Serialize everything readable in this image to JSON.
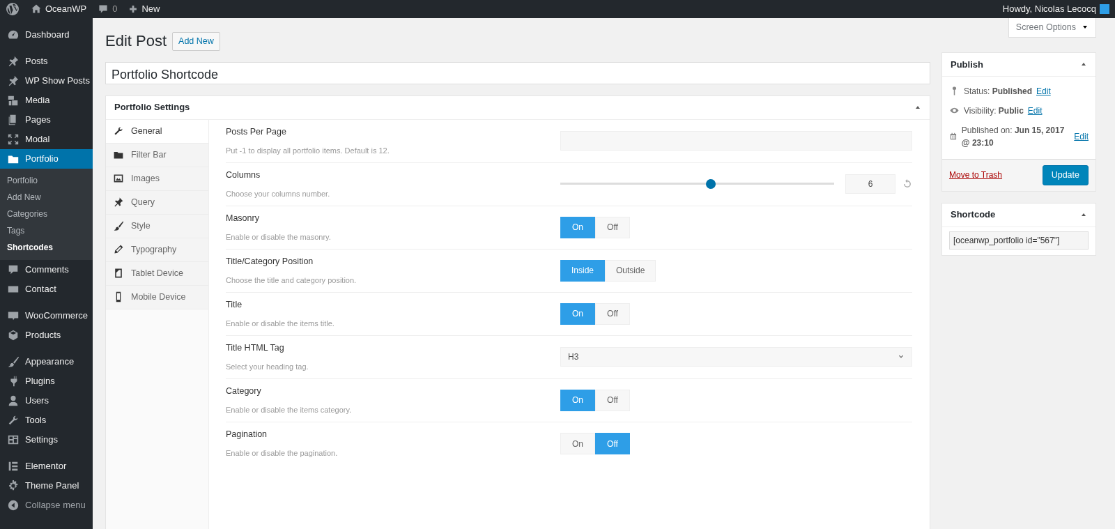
{
  "admin_bar": {
    "site": "OceanWP",
    "comments": "0",
    "new": "New",
    "greeting": "Howdy, Nicolas Lecocq"
  },
  "sidebar": {
    "groups": [
      [
        {
          "label": "Dashboard",
          "selected": false
        }
      ],
      [
        {
          "label": "Posts",
          "selected": false
        },
        {
          "label": "WP Show Posts",
          "selected": false
        },
        {
          "label": "Media",
          "selected": false
        },
        {
          "label": "Pages",
          "selected": false
        },
        {
          "label": "Modal",
          "selected": false
        },
        {
          "label": "Portfolio",
          "selected": true,
          "children": [
            {
              "label": "Portfolio",
              "selected": false
            },
            {
              "label": "Add New",
              "selected": false
            },
            {
              "label": "Categories",
              "selected": false
            },
            {
              "label": "Tags",
              "selected": false
            },
            {
              "label": "Shortcodes",
              "selected": true
            }
          ]
        },
        {
          "label": "Comments",
          "selected": false
        },
        {
          "label": "Contact",
          "selected": false
        }
      ],
      [
        {
          "label": "WooCommerce",
          "selected": false
        },
        {
          "label": "Products",
          "selected": false
        }
      ],
      [
        {
          "label": "Appearance",
          "selected": false
        },
        {
          "label": "Plugins",
          "selected": false
        },
        {
          "label": "Users",
          "selected": false
        },
        {
          "label": "Tools",
          "selected": false
        },
        {
          "label": "Settings",
          "selected": false
        }
      ],
      [
        {
          "label": "Elementor",
          "selected": false
        },
        {
          "label": "Theme Panel",
          "selected": false
        },
        {
          "label": "Collapse menu",
          "selected": false
        }
      ]
    ]
  },
  "screen_options": "Screen Options",
  "page_title": "Edit Post",
  "add_new": "Add New",
  "post_title": "Portfolio Shortcode",
  "settings_box": {
    "title": "Portfolio Settings",
    "tabs": [
      {
        "label": "General",
        "selected": true
      },
      {
        "label": "Filter Bar",
        "selected": false
      },
      {
        "label": "Images",
        "selected": false
      },
      {
        "label": "Query",
        "selected": false
      },
      {
        "label": "Style",
        "selected": false
      },
      {
        "label": "Typography",
        "selected": false
      },
      {
        "label": "Tablet Device",
        "selected": false
      },
      {
        "label": "Mobile Device",
        "selected": false
      }
    ],
    "rows": [
      {
        "kind": "text",
        "label": "Posts Per Page",
        "description": "Put -1 to display all portfolio items. Default is 12."
      },
      {
        "kind": "slider",
        "label": "Columns",
        "description": "Choose your columns number.",
        "level": 0.55,
        "value": "6"
      },
      {
        "kind": "toggle",
        "label": "Masonry",
        "description": "Enable or disable the masonry.",
        "options": [
          {
            "label": "On",
            "selected": true
          },
          {
            "label": "Off",
            "selected": false
          }
        ]
      },
      {
        "kind": "toggle",
        "label": "Title/Category Position",
        "description": "Choose the title and category position.",
        "options": [
          {
            "label": "Inside",
            "selected": true
          },
          {
            "label": "Outside",
            "selected": false
          }
        ]
      },
      {
        "kind": "toggle",
        "label": "Title",
        "description": "Enable or disable the items title.",
        "options": [
          {
            "label": "On",
            "selected": true
          },
          {
            "label": "Off",
            "selected": false
          }
        ]
      },
      {
        "kind": "select",
        "label": "Title HTML Tag",
        "description": "Select your heading tag.",
        "value": "H3"
      },
      {
        "kind": "toggle",
        "label": "Category",
        "description": "Enable or disable the items category.",
        "options": [
          {
            "label": "On",
            "selected": true
          },
          {
            "label": "Off",
            "selected": false
          }
        ]
      },
      {
        "kind": "toggle",
        "label": "Pagination",
        "description": "Enable or disable the pagination.",
        "options": [
          {
            "label": "On",
            "selected": false
          },
          {
            "label": "Off",
            "selected": true
          }
        ]
      }
    ]
  },
  "publish_box": {
    "title": "Publish",
    "items": [
      {
        "label": "Status:",
        "value": "Published",
        "link": "Edit"
      },
      {
        "label": "Visibility:",
        "value": "Public",
        "link": "Edit"
      },
      {
        "label": "Published on:",
        "value": "Jun 15, 2017 @ 23:10",
        "link": "Edit"
      }
    ],
    "trash": "Move to Trash",
    "update": "Update"
  },
  "shortcode_box": {
    "title": "Shortcode",
    "value": "[oceanwp_portfolio id=\"567\"]"
  }
}
